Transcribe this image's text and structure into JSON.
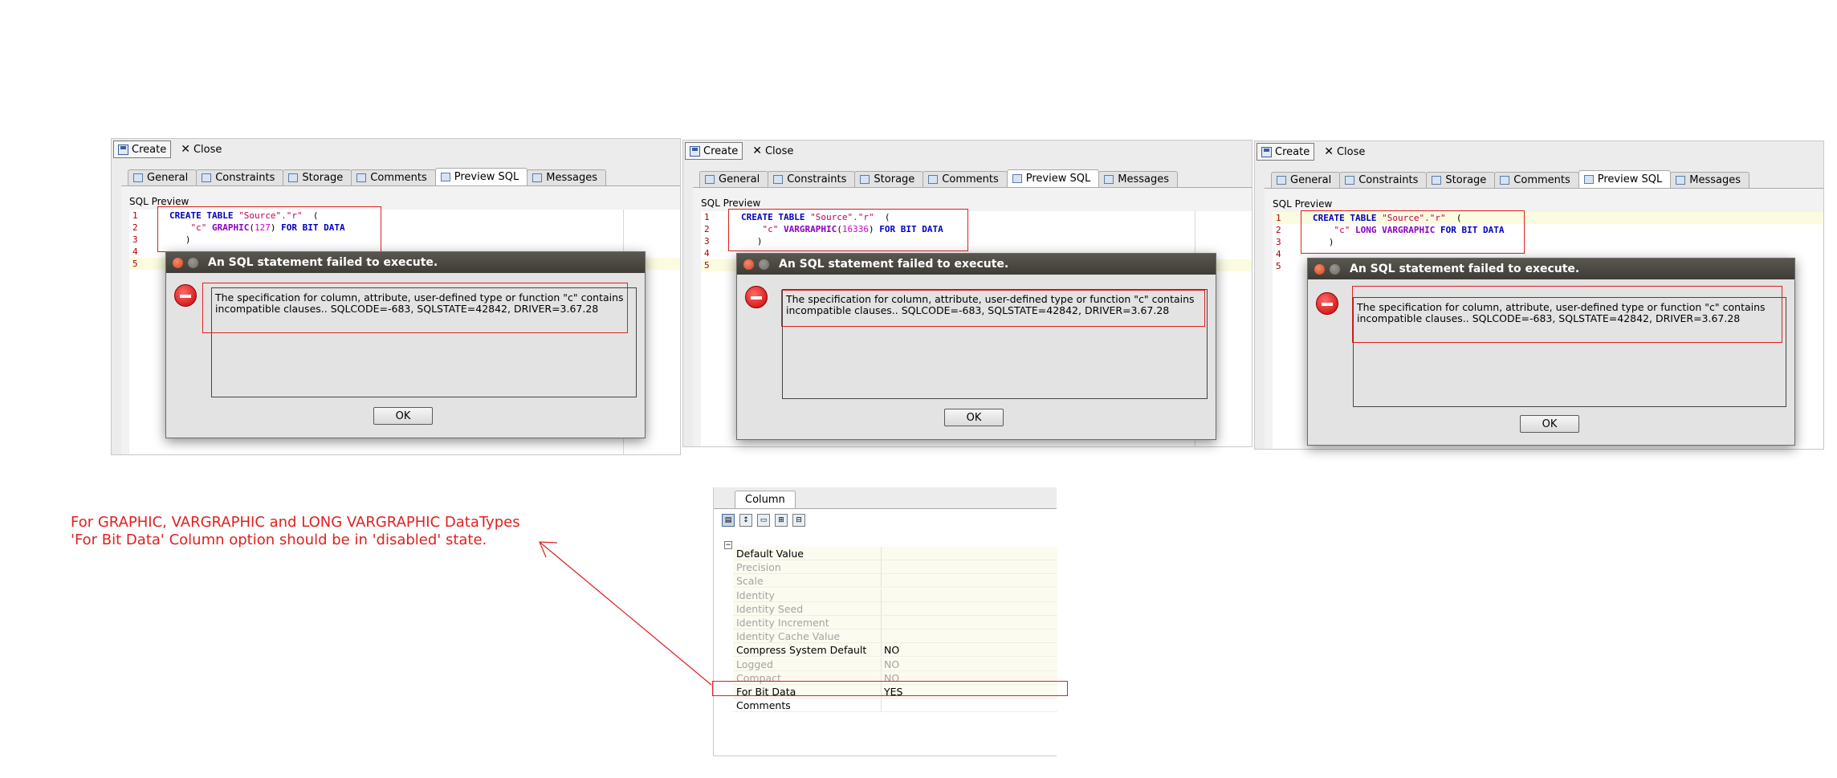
{
  "panels": [
    {
      "toolbar": {
        "create_label": "Create",
        "close_label": "Close"
      },
      "tabs": [
        "General",
        "Constraints",
        "Storage",
        "Comments",
        "Preview SQL",
        "Messages"
      ],
      "active_tab": "Preview SQL",
      "sql_preview_label": "SQL Preview",
      "line_numbers": [
        "1",
        "2",
        "3",
        "4",
        "5"
      ],
      "sql": {
        "l1_kw1": "CREATE",
        "l1_kw2": "TABLE",
        "l1_str": "\"Source\".\"r\"",
        "l1_paren": "(",
        "l2_col": "\"c\"",
        "l2_type": "GRAPHIC",
        "l2_num": "127",
        "l2_rest": "FOR BIT DATA",
        "l3": ")"
      },
      "dialog": {
        "title": "An SQL statement failed to execute.",
        "message": "The specification for column, attribute, user-defined type or function \"c\" contains incompatible clauses.. SQLCODE=-683, SQLSTATE=42842, DRIVER=3.67.28",
        "ok_label": "OK"
      }
    },
    {
      "toolbar": {
        "create_label": "Create",
        "close_label": "Close"
      },
      "tabs": [
        "General",
        "Constraints",
        "Storage",
        "Comments",
        "Preview SQL",
        "Messages"
      ],
      "active_tab": "Preview SQL",
      "sql_preview_label": "SQL Preview",
      "line_numbers": [
        "1",
        "2",
        "3",
        "4",
        "5"
      ],
      "sql": {
        "l1_kw1": "CREATE",
        "l1_kw2": "TABLE",
        "l1_str": "\"Source\".\"r\"",
        "l1_paren": "(",
        "l2_col": "\"c\"",
        "l2_type": "VARGRAPHIC",
        "l2_num": "16336",
        "l2_rest": "FOR BIT DATA",
        "l3": ")"
      },
      "dialog": {
        "title": "An SQL statement failed to execute.",
        "message": "The specification for column, attribute, user-defined type or function \"c\" contains incompatible clauses.. SQLCODE=-683, SQLSTATE=42842, DRIVER=3.67.28",
        "ok_label": "OK"
      }
    },
    {
      "toolbar": {
        "create_label": "Create",
        "close_label": "Close"
      },
      "tabs": [
        "General",
        "Constraints",
        "Storage",
        "Comments",
        "Preview SQL",
        "Messages"
      ],
      "active_tab": "Preview SQL",
      "sql_preview_label": "SQL Preview",
      "line_numbers": [
        "1",
        "2",
        "3",
        "4",
        "5"
      ],
      "sql": {
        "l1_kw1": "CREATE",
        "l1_kw2": "TABLE",
        "l1_str": "\"Source\".\"r\"",
        "l1_paren": "(",
        "l2_col": "\"c\"",
        "l2_type": "LONG VARGRAPHIC",
        "l2_num": "",
        "l2_rest": "FOR BIT DATA",
        "l3": ")"
      },
      "dialog": {
        "title": "An SQL statement failed to execute.",
        "message": "The specification for column, attribute, user-defined type or function \"c\" contains incompatible clauses.. SQLCODE=-683, SQLSTATE=42842, DRIVER=3.67.28",
        "ok_label": "OK"
      }
    }
  ],
  "properties": {
    "tab_label": "Column",
    "rows": [
      {
        "name": "Default Value",
        "value": "",
        "disabled": false
      },
      {
        "name": "Precision",
        "value": "",
        "disabled": true
      },
      {
        "name": "Scale",
        "value": "",
        "disabled": true
      },
      {
        "name": "Identity",
        "value": "",
        "disabled": true
      },
      {
        "name": "Identity Seed",
        "value": "",
        "disabled": true
      },
      {
        "name": "Identity Increment",
        "value": "",
        "disabled": true
      },
      {
        "name": "Identity Cache Value",
        "value": "",
        "disabled": true
      },
      {
        "name": "Compress System Default",
        "value": "NO",
        "disabled": false
      },
      {
        "name": "Logged",
        "value": "NO",
        "disabled": true
      },
      {
        "name": "Compact",
        "value": "NO",
        "disabled": true
      },
      {
        "name": "For Bit Data",
        "value": "YES",
        "disabled": false
      },
      {
        "name": "Comments",
        "value": "",
        "disabled": false
      }
    ]
  },
  "annotation": {
    "line1": "For GRAPHIC, VARGRAPHIC and LONG VARGRAPHIC DataTypes",
    "line2": "'For Bit Data' Column option should be in 'disabled' state.",
    "color": "#e02020"
  }
}
